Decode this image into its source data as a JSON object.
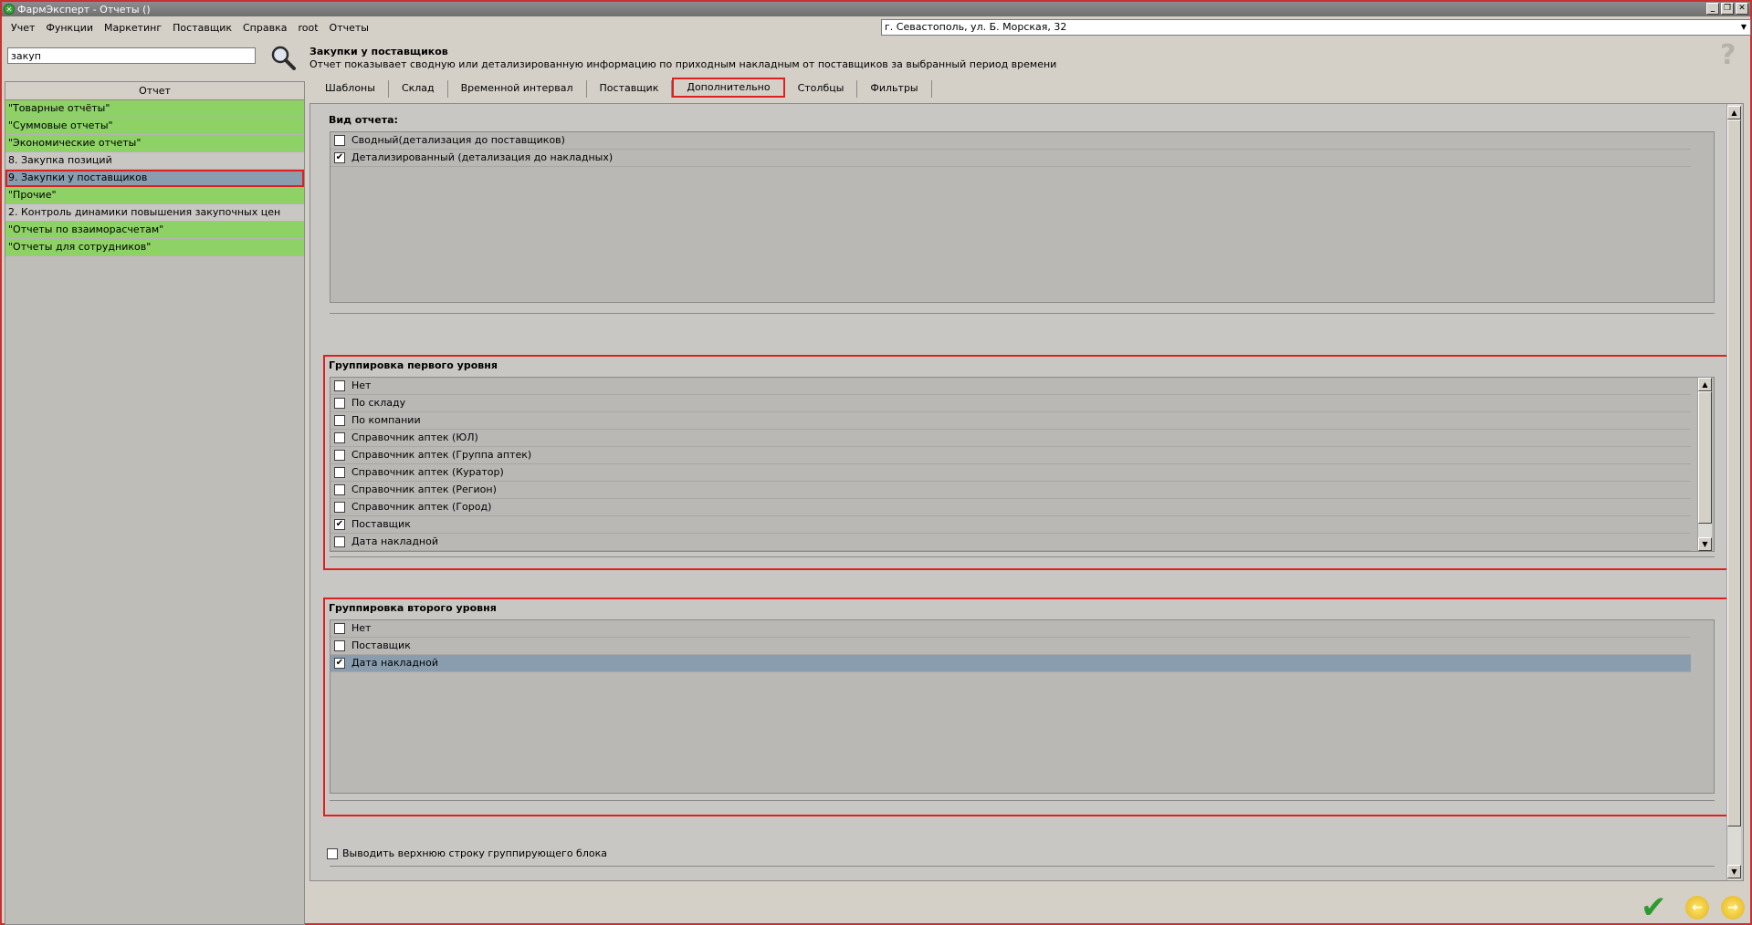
{
  "window": {
    "title": "ФармЭксперт - Отчеты ()",
    "controls": [
      "_",
      "❐",
      "✕"
    ]
  },
  "menu": [
    "Учет",
    "Функции",
    "Маркетинг",
    "Поставщик",
    "Справка",
    "root",
    "Отчеты"
  ],
  "location": "г. Севастополь, ул. Б. Морская, 32",
  "search": {
    "value": "закуп"
  },
  "report": {
    "title": "Закупки у поставщиков",
    "description": "Отчет показывает сводную или детализированную информацию по приходным накладным от поставщиков за выбранный период времени"
  },
  "tree": {
    "header": "Отчет",
    "items": [
      {
        "label": "\"Товарные отчёты\"",
        "style": "green"
      },
      {
        "label": "\"Суммовые отчеты\"",
        "style": "green"
      },
      {
        "label": "\"Экономические отчеты\"",
        "style": "green"
      },
      {
        "label": "8. Закупка позиций",
        "style": "grey"
      },
      {
        "label": "9. Закупки у поставщиков",
        "style": "sel"
      },
      {
        "label": "\"Прочие\"",
        "style": "green"
      },
      {
        "label": "2. Контроль динамики повышения закупочных цен",
        "style": "grey"
      },
      {
        "label": "\"Отчеты по взаиморасчетам\"",
        "style": "green"
      },
      {
        "label": "\"Отчеты для сотрудников\"",
        "style": "green"
      }
    ]
  },
  "tabs": [
    "Шаблоны",
    "Склад",
    "Временной интервал",
    "Поставщик",
    "Дополнительно",
    "Столбцы",
    "Фильтры"
  ],
  "active_tab": "Дополнительно",
  "report_type": {
    "label": "Вид отчета:",
    "options": [
      {
        "label": "Сводный(детализация до поставщиков)",
        "checked": false
      },
      {
        "label": "Детализированный (детализация до накладных)",
        "checked": true
      }
    ]
  },
  "group1": {
    "label": "Группировка первого уровня",
    "options": [
      {
        "label": "Нет",
        "checked": false
      },
      {
        "label": "По складу",
        "checked": false
      },
      {
        "label": "По компании",
        "checked": false
      },
      {
        "label": "Справочник аптек (ЮЛ)",
        "checked": false
      },
      {
        "label": "Справочник аптек (Группа аптек)",
        "checked": false
      },
      {
        "label": "Справочник аптек (Куратор)",
        "checked": false
      },
      {
        "label": "Справочник аптек (Регион)",
        "checked": false
      },
      {
        "label": "Справочник аптек (Город)",
        "checked": false
      },
      {
        "label": "Поставщик",
        "checked": true
      },
      {
        "label": "Дата накладной",
        "checked": false
      }
    ]
  },
  "group2": {
    "label": "Группировка второго уровня",
    "options": [
      {
        "label": "Нет",
        "checked": false
      },
      {
        "label": "Поставщик",
        "checked": false
      },
      {
        "label": "Дата накладной",
        "checked": true
      }
    ]
  },
  "header_row_option": {
    "label": "Выводить верхнюю строку группирующего блока",
    "checked": false
  },
  "colors": {
    "accent_red": "#e02020",
    "tree_green": "#8ed165",
    "selection": "#8a9daf"
  }
}
